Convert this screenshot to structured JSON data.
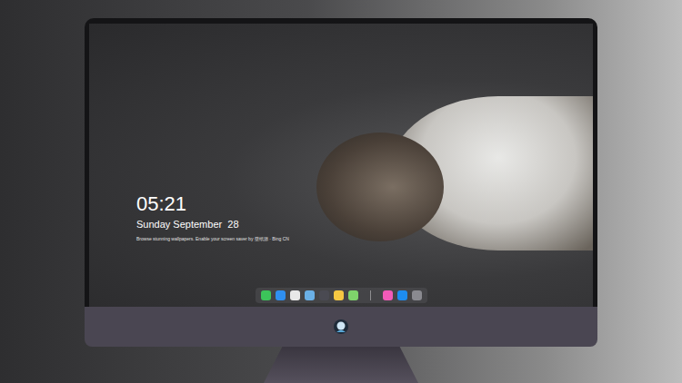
{
  "lock_screen": {
    "time": "05:21",
    "date": "Sunday September  28",
    "caption": "Browse stunning wallpapers. Enable your screen saver by 壁纸源 · Bing CN"
  },
  "dock": {
    "apps": [
      {
        "color": "#3cc45a"
      },
      {
        "color": "#2f8ff0"
      },
      {
        "color": "#e8e8e8"
      },
      {
        "color": "#6ab0e6"
      },
      {
        "color": "#4a4a52"
      },
      {
        "color": "#f5c842"
      },
      {
        "color": "#7fd36b"
      }
    ],
    "pinned": [
      {
        "color": "#f25ab8"
      },
      {
        "color": "#1d8cf0"
      },
      {
        "color": "#8a8a90"
      }
    ]
  }
}
